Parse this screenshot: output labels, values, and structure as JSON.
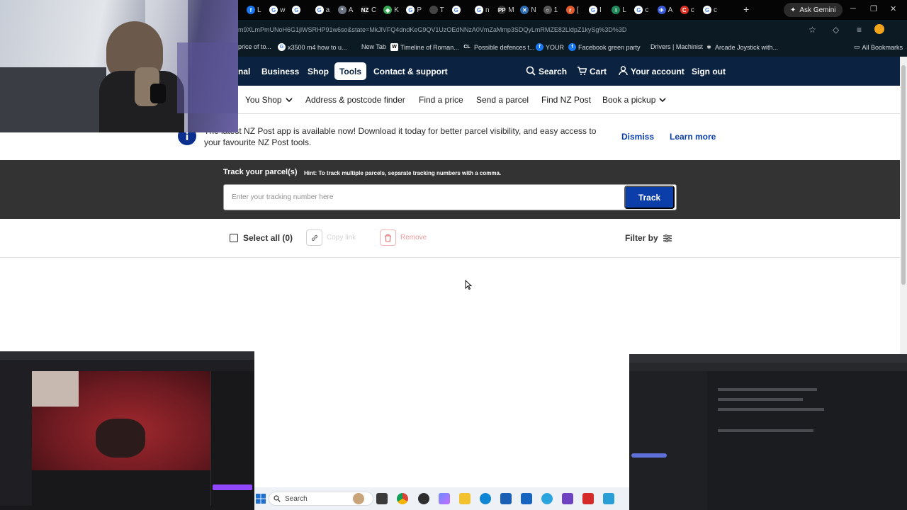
{
  "browser": {
    "tabs": [
      {
        "label": "L",
        "color": "#1877f2",
        "glyph": "f"
      },
      {
        "label": "w",
        "color": "#ffffff",
        "glyph": "G"
      },
      {
        "label": "",
        "color": "#ffffff",
        "glyph": "G"
      },
      {
        "label": "a",
        "color": "#ffffff",
        "glyph": "G"
      },
      {
        "label": "A",
        "color": "#6a7380",
        "glyph": "*"
      },
      {
        "label": "C",
        "color": "#1a1a1a",
        "glyph": "NZ"
      },
      {
        "label": "K",
        "color": "#34a853",
        "glyph": "◆"
      },
      {
        "label": "P",
        "color": "#ffffff",
        "glyph": "G"
      },
      {
        "label": "T",
        "color": "#444444",
        "glyph": ""
      },
      {
        "label": "",
        "color": "#ffffff",
        "glyph": "G"
      },
      {
        "label": "n",
        "color": "#ffffff",
        "glyph": "G"
      },
      {
        "label": "M",
        "color": "#333333",
        "glyph": "PP"
      },
      {
        "label": "N",
        "color": "#2b6cb0",
        "glyph": "✕"
      },
      {
        "label": "1",
        "color": "#555555",
        "glyph": "○"
      },
      {
        "label": "[",
        "color": "#e45b2b",
        "glyph": "r"
      },
      {
        "label": "I",
        "color": "#ffffff",
        "glyph": "G"
      },
      {
        "label": "L",
        "color": "#1f8a5b",
        "glyph": "i"
      },
      {
        "label": "c",
        "color": "#ffffff",
        "glyph": "G"
      },
      {
        "label": "A",
        "color": "#3a5bd9",
        "glyph": "✈"
      },
      {
        "label": "c",
        "color": "#d93025",
        "glyph": "C"
      },
      {
        "label": "c",
        "color": "#ffffff",
        "glyph": "G"
      }
    ],
    "new_tab": "+",
    "ask_gemini": "Ask Gemini",
    "url": "m9XLmPmUNoH6G1jlWSRHP91w6so&state=MkJlVFQ4dndKeG9QV1UzOEdNNzA0VmZaMmp3SDQyLmRMZE82LldpZ1kySg%3D%3D",
    "bookmarks": [
      {
        "label": "price of to...",
        "icon": ""
      },
      {
        "label": "x3500 m4 how to u...",
        "icon": "G"
      },
      {
        "label": "New Tab",
        "icon": ""
      },
      {
        "label": "Timeline of Roman...",
        "icon": "W"
      },
      {
        "label": "Possible defences t...",
        "icon": "CL"
      },
      {
        "label": "YOUR",
        "icon": "f"
      },
      {
        "label": "Facebook green party",
        "icon": "f"
      },
      {
        "label": "Drivers | Machinist",
        "icon": ""
      },
      {
        "label": "Arcade Joystick with...",
        "icon": "✱"
      }
    ],
    "all_bookmarks": "All Bookmarks"
  },
  "site": {
    "top_nav": {
      "personal_fragment": "nal",
      "business": "Business",
      "shop": "Shop",
      "tools": "Tools",
      "contact": "Contact & support",
      "search": "Search",
      "cart": "Cart",
      "account": "Your account",
      "signout": "Sign out"
    },
    "sub_nav": {
      "you_shop": "You Shop",
      "address_finder": "Address & postcode finder",
      "find_price": "Find a price",
      "send_parcel": "Send a parcel",
      "find_nz_post": "Find NZ Post",
      "book_pickup": "Book a pickup"
    },
    "banner": {
      "text": "The latest NZ Post app is available now! Download it today for better parcel visibility, and easy access to your favourite NZ Post tools.",
      "dismiss": "Dismiss",
      "learn_more": "Learn more"
    },
    "tracker": {
      "title": "Track your parcel(s)",
      "hint": "Hint: To track multiple parcels, separate tracking numbers with a comma.",
      "placeholder": "Enter your tracking number here",
      "value": "",
      "button": "Track"
    },
    "toolbar": {
      "select_all": "Select all (0)",
      "copy_link": "Copy link",
      "remove": "Remove",
      "filter_by": "Filter by"
    }
  },
  "taskbar": {
    "search": "Search"
  },
  "colors": {
    "brand_navy": "#0b2341",
    "accent_blue": "#0b3ea8",
    "tracker_bg": "#333333"
  }
}
